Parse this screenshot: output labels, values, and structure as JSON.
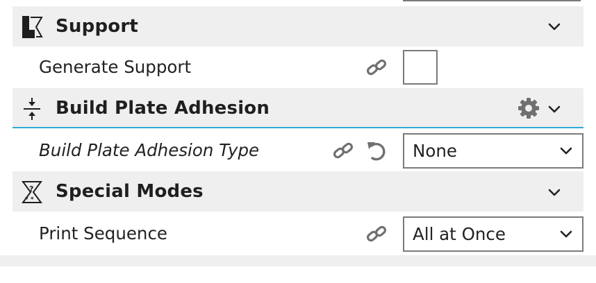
{
  "categories": [
    {
      "title": "Support",
      "icon": "support-icon"
    },
    {
      "title": "Build Plate Adhesion",
      "icon": "adhesion-icon",
      "has_settings_gear": true
    },
    {
      "title": "Special Modes",
      "icon": "special-modes-icon"
    }
  ],
  "settings": {
    "generate_support": {
      "label": "Generate Support",
      "checked": false
    },
    "adhesion_type": {
      "label": "Build Plate Adhesion Type",
      "value": "None",
      "modified": true
    },
    "print_sequence": {
      "label": "Print Sequence",
      "value": "All at Once"
    }
  },
  "colors": {
    "category_background": "#efefef",
    "active_underline": "#2ea9d8",
    "field_border": "#7a7a7a",
    "icon_gray": "#707070"
  }
}
